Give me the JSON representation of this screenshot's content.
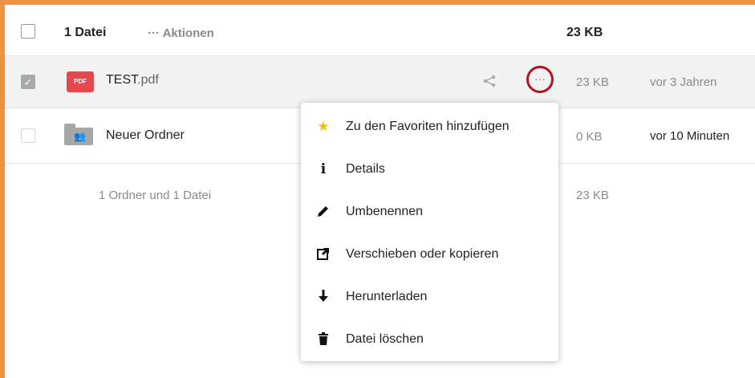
{
  "header": {
    "count_label": "1 Datei",
    "actions_label": "··· Aktionen",
    "size_label": "23 KB"
  },
  "files": [
    {
      "name": "TEST",
      "ext": ".pdf",
      "icon": "pdf-icon",
      "icon_text": "PDF",
      "size": "23 KB",
      "modified": "vor 3 Jahren",
      "selected": true
    },
    {
      "name": "Neuer Ordner",
      "ext": "",
      "icon": "shared-folder-icon",
      "size": "0 KB",
      "modified": "vor 10 Minuten",
      "selected": false
    }
  ],
  "summary": {
    "text": "1 Ordner und 1 Datei",
    "size": "23 KB"
  },
  "context_menu": {
    "items": [
      {
        "label": "Zu den Favoriten hinzufügen",
        "icon": "star-icon"
      },
      {
        "label": "Details",
        "icon": "info-icon"
      },
      {
        "label": "Umbenennen",
        "icon": "pencil-icon"
      },
      {
        "label": "Verschieben oder kopieren",
        "icon": "external-link-icon"
      },
      {
        "label": "Herunterladen",
        "icon": "download-arrow-icon"
      },
      {
        "label": "Datei löschen",
        "icon": "trash-icon"
      }
    ]
  },
  "colors": {
    "frame": "#f0913f",
    "pdf_red": "#e5484d",
    "highlight_circle": "#b3121f",
    "star": "#f5c000"
  }
}
